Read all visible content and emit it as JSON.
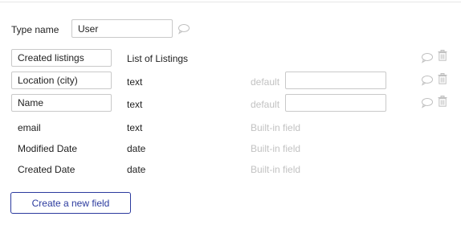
{
  "type_name": {
    "label": "Type name",
    "value": "User"
  },
  "fields": [
    {
      "name": "Created listings",
      "type": "List of Listings",
      "default_label": "",
      "default_value": "",
      "editable": true
    },
    {
      "name": "Location (city)",
      "type": "text",
      "default_label": "default",
      "default_value": "",
      "editable": true
    },
    {
      "name": "Name",
      "type": "text",
      "default_label": "default",
      "default_value": "",
      "editable": true
    },
    {
      "name": "email",
      "type": "text",
      "note": "Built-in field",
      "editable": false
    },
    {
      "name": "Modified Date",
      "type": "date",
      "note": "Built-in field",
      "editable": false
    },
    {
      "name": "Created Date",
      "type": "date",
      "note": "Built-in field",
      "editable": false
    }
  ],
  "icons": {
    "comment": "comment-icon",
    "trash": "trash-icon"
  },
  "colors": {
    "accent": "#2b3a9e",
    "muted_text": "#c2c2c2",
    "icon": "#bfbfbf"
  },
  "create_button_label": "Create a new field"
}
